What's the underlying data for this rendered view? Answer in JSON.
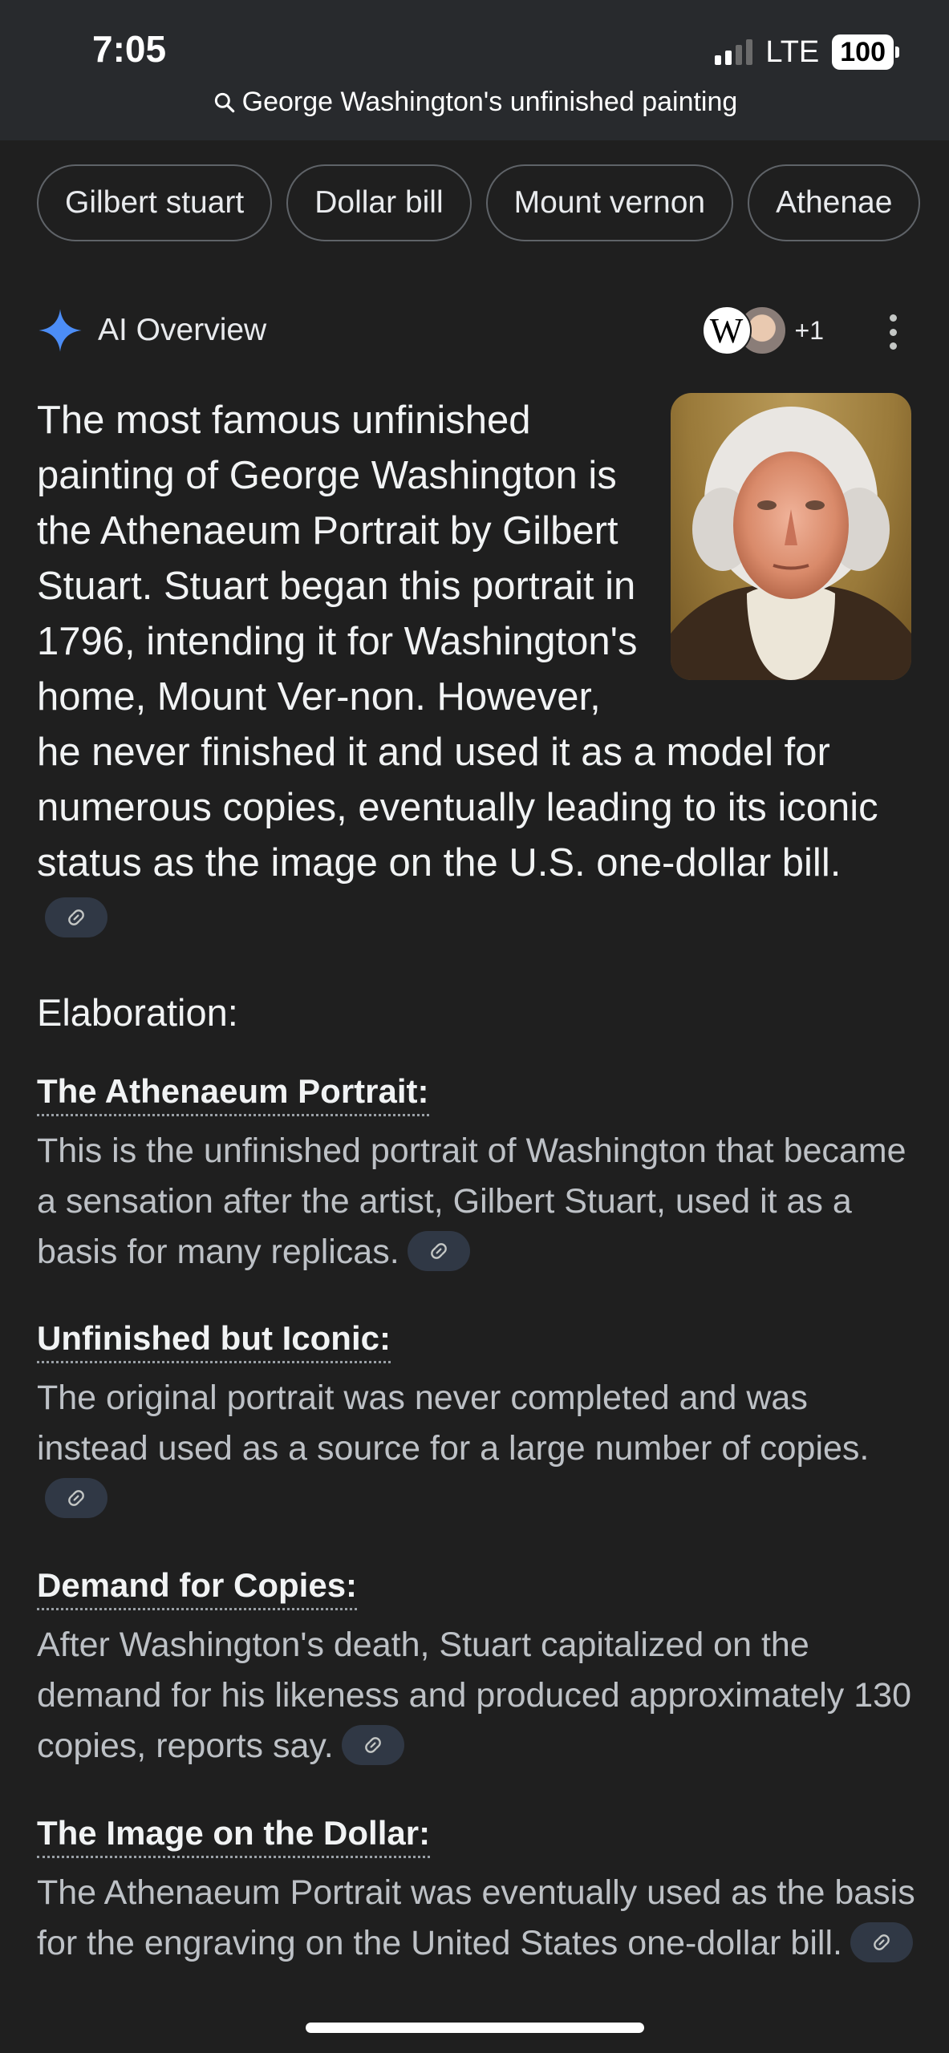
{
  "status_bar": {
    "time": "7:05",
    "network": "LTE",
    "battery": "100"
  },
  "search": {
    "query": "George Washington's unfinished painting"
  },
  "chips": [
    "Gilbert stuart",
    "Dollar bill",
    "Mount vernon",
    "Athenae"
  ],
  "ai_overview": {
    "title": "AI Overview",
    "sources_more": "+1",
    "summary": "The most famous unfinished painting of George Washington is the Athenaeum Portrait by Gilbert Stuart. Stuart began this portrait in 1796, intending it for Washington's home, Mount Ver-non. However, he never finished it and used it as a model for numerous copies, eventually leading to its iconic status as the image on the U.S. one-dollar bill."
  },
  "elaboration": {
    "title": "Elaboration:",
    "items": [
      {
        "heading": "The Athenaeum Portrait:",
        "body": "This is the unfinished portrait of Washington that became a sensation after the artist, Gilbert Stuart, used it as a basis for many replicas."
      },
      {
        "heading": "Unfinished but Iconic:",
        "body": "The original portrait was never completed and was instead used as a source for a large number of copies."
      },
      {
        "heading": "Demand for Copies:",
        "body": "After Washington's death, Stuart capitalized on the demand for his likeness and produced approximately 130 copies, reports say."
      },
      {
        "heading": "The Image on the Dollar:",
        "body": "The Athenaeum Portrait was eventually used as the basis for the engraving on the United States one-dollar bill."
      }
    ]
  },
  "colors": {
    "background": "#1f1f1f",
    "top_bar": "#282a2d",
    "link_chip": "#303845",
    "spark": "#4c8df6"
  }
}
